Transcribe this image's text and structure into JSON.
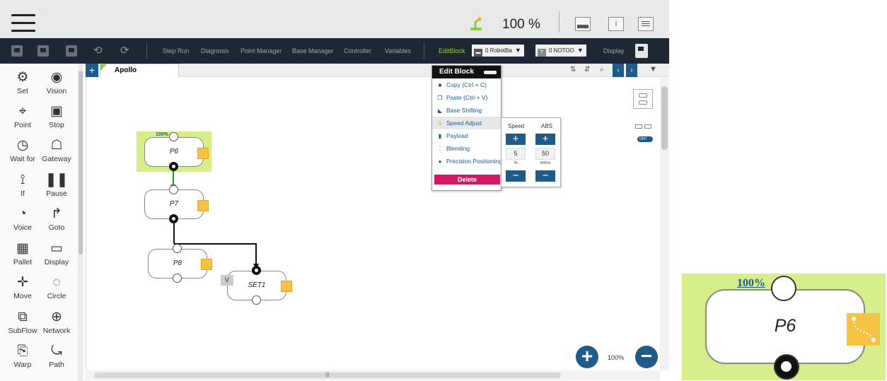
{
  "topbar": {
    "speed_percent": "100 %"
  },
  "toolbar": {
    "items": [
      "Step Run",
      "Diagnosis",
      "Point Manager",
      "Base Manager",
      "Controller",
      "Variables"
    ],
    "edit_block": "EditBlock",
    "robot_base_dropdown": "0 RobotBa",
    "tool_dropdown": "0 NOTOO",
    "display": "Display"
  },
  "sidebar": {
    "items": [
      {
        "label": "Set",
        "icon": "set-icon"
      },
      {
        "label": "Vision",
        "icon": "vision-icon"
      },
      {
        "label": "Point",
        "icon": "point-icon"
      },
      {
        "label": "Stop",
        "icon": "stop-icon"
      },
      {
        "label": "Wait for",
        "icon": "wait-icon"
      },
      {
        "label": "Gateway",
        "icon": "gateway-icon"
      },
      {
        "label": "If",
        "icon": "if-icon"
      },
      {
        "label": "Pause",
        "icon": "pause-icon"
      },
      {
        "label": "Voice",
        "icon": "voice-icon"
      },
      {
        "label": "Goto",
        "icon": "goto-icon"
      },
      {
        "label": "Pallet",
        "icon": "pallet-icon"
      },
      {
        "label": "Display",
        "icon": "display-icon"
      },
      {
        "label": "Move",
        "icon": "move-icon"
      },
      {
        "label": "Circle",
        "icon": "circle-icon"
      },
      {
        "label": "SubFlow",
        "icon": "subflow-icon"
      },
      {
        "label": "Network",
        "icon": "network-icon"
      },
      {
        "label": "Warp",
        "icon": "warp-icon"
      },
      {
        "label": "Path",
        "icon": "path-icon"
      }
    ]
  },
  "tab": {
    "plus": "+",
    "name": "Apollo"
  },
  "flow": {
    "nodes": [
      {
        "label": "P6",
        "percent": "100%",
        "selected": true
      },
      {
        "label": "P7"
      },
      {
        "label": "P8"
      },
      {
        "label": "SET1",
        "tag": "V"
      }
    ]
  },
  "edit_block_menu": {
    "title": "Edit Block",
    "items": [
      {
        "label": "Copy (Ctrl + C)",
        "icon": "copy-icon"
      },
      {
        "label": "Paste (Ctrl + V)",
        "icon": "paste-icon"
      },
      {
        "label": "Base Shifting",
        "icon": "base-shifting-icon"
      },
      {
        "label": "Speed Adjust",
        "icon": "speed-adjust-icon",
        "selected": true
      },
      {
        "label": "Payload",
        "icon": "payload-icon"
      },
      {
        "label": "Blending",
        "icon": "blending-icon"
      },
      {
        "label": "Precision Positioning",
        "icon": "location-pin-icon"
      }
    ],
    "delete_label": "Delete"
  },
  "speed_panel": {
    "speed_label": "Speed",
    "abs_label": "ABS",
    "speed_value": "5",
    "abs_value": "50",
    "speed_unit": "%",
    "abs_unit": "mm/s"
  },
  "right_tools": {
    "toggle_label": "OFF"
  },
  "zoom": {
    "level": "100%"
  },
  "zoom_preview": {
    "label": "P6",
    "percent": "100%"
  },
  "colors": {
    "toolbar_bg": "#1e2832",
    "accent_blue": "#1e5a8a",
    "selection_green": "#d6ee8a",
    "edit_block_green": "#8ecf3c",
    "delete_magenta": "#d21963",
    "block_icon_yellow": "#f5c242"
  }
}
